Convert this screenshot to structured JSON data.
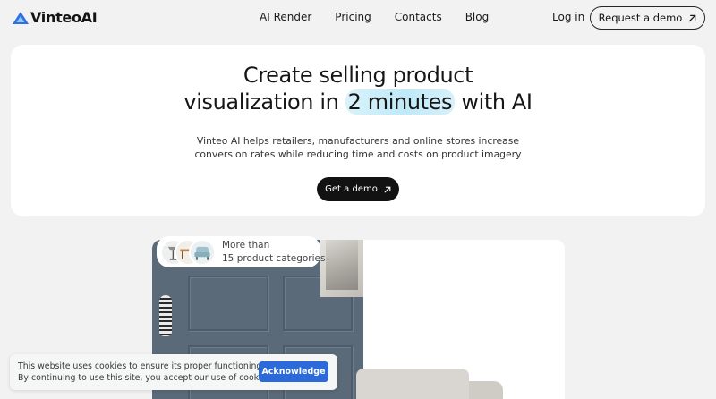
{
  "header": {
    "logo_text": "VinteoAI",
    "nav": [
      "AI Render",
      "Pricing",
      "Contacts",
      "Blog"
    ],
    "login_label": "Log in",
    "request_demo_label": "Request a demo"
  },
  "hero": {
    "title_line1": "Create selling product",
    "title_line2_before": "visualization in ",
    "title_highlight": "2 minutes",
    "title_line2_after": " with AI",
    "subtitle_line1": "Vinteo AI helps retailers, manufacturers and online stores increase",
    "subtitle_line2": "conversion rates while reducing time and costs on product imagery",
    "cta_label": "Get a demo"
  },
  "preview": {
    "badge_line1": "More than",
    "badge_line2": "15 product categories"
  },
  "cookie": {
    "line1": "This website uses cookies to ensure its proper functioning.",
    "line2": "By continuing to use this site, you accept our use of cookies.",
    "button_label": "Acknowledge"
  },
  "colors": {
    "page_background": "#f1f2f1",
    "dark": "#121212",
    "highlight": "#c9eef9",
    "logo_blue": "#2f6fe0",
    "cookie_button": "#2d6ad9"
  },
  "icons": [
    "vinteo-logo-icon",
    "arrow-up-right-icon"
  ]
}
